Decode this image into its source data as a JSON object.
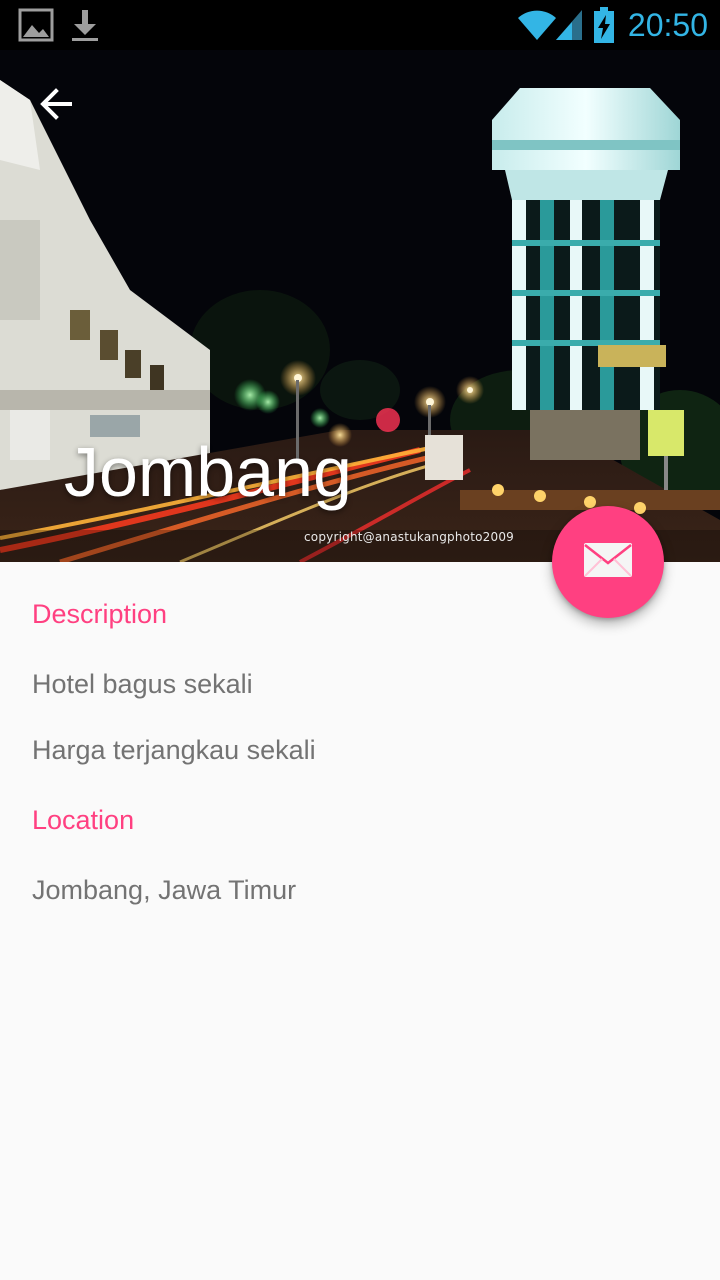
{
  "status_bar": {
    "time": "20:50",
    "icons": [
      "image-notification-icon",
      "download-notification-icon",
      "wifi-icon",
      "cell-signal-icon",
      "battery-charging-icon"
    ],
    "accent_color": "#33b5e5"
  },
  "header": {
    "title": "Jombang",
    "back_icon": "arrow-back-icon",
    "photo_credit": "copyright@anastukangphoto2009"
  },
  "fab": {
    "icon": "mail-icon",
    "color": "#ff4081"
  },
  "description": {
    "heading": "Description",
    "lines": [
      "Hotel bagus sekali",
      "Harga terjangkau sekali"
    ]
  },
  "location": {
    "heading": "Location",
    "value": "Jombang, Jawa Timur"
  },
  "colors": {
    "accent": "#ff4081",
    "body_text": "#737373",
    "background": "#fafafa"
  }
}
